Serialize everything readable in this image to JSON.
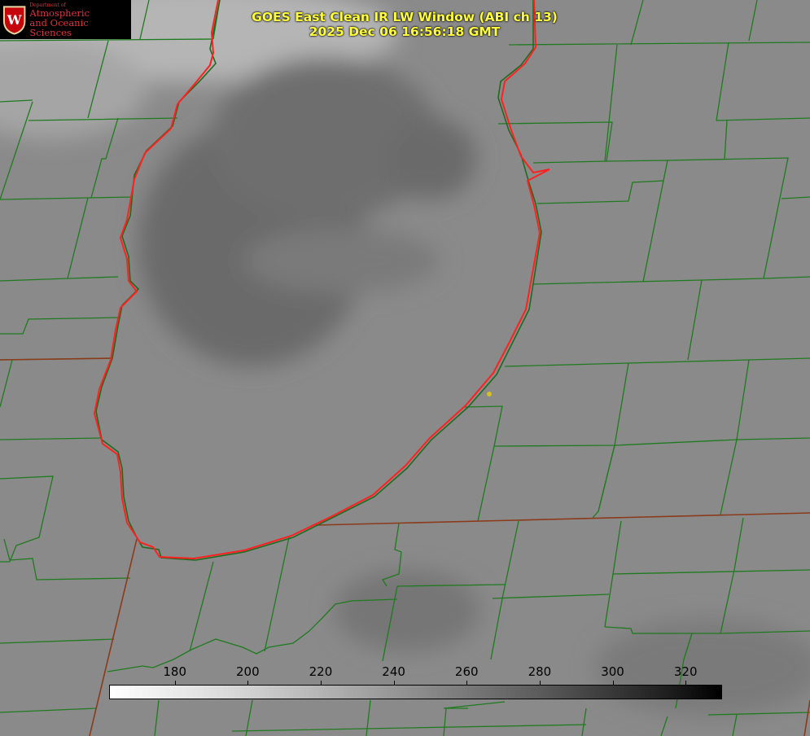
{
  "title": {
    "line1": "GOES East Clean IR LW Window (ABI ch 13)",
    "line2": "2025 Dec 06 16:56:18 GMT"
  },
  "logo": {
    "dept": "Department of",
    "line1": "Atmospheric",
    "line2": "and Oceanic Sciences",
    "seal_letter": "W"
  },
  "colorbar": {
    "ticks": [
      180,
      200,
      220,
      240,
      260,
      280,
      300,
      320
    ],
    "min": 162,
    "max": 330
  },
  "colors": {
    "county_lines": "#1f7a1f",
    "state_lines": "#8b3a1a",
    "lake_shore": "#ff2020",
    "title_text": "#ffff3c",
    "marker": "#d8c020"
  },
  "marker": {
    "label": ""
  }
}
